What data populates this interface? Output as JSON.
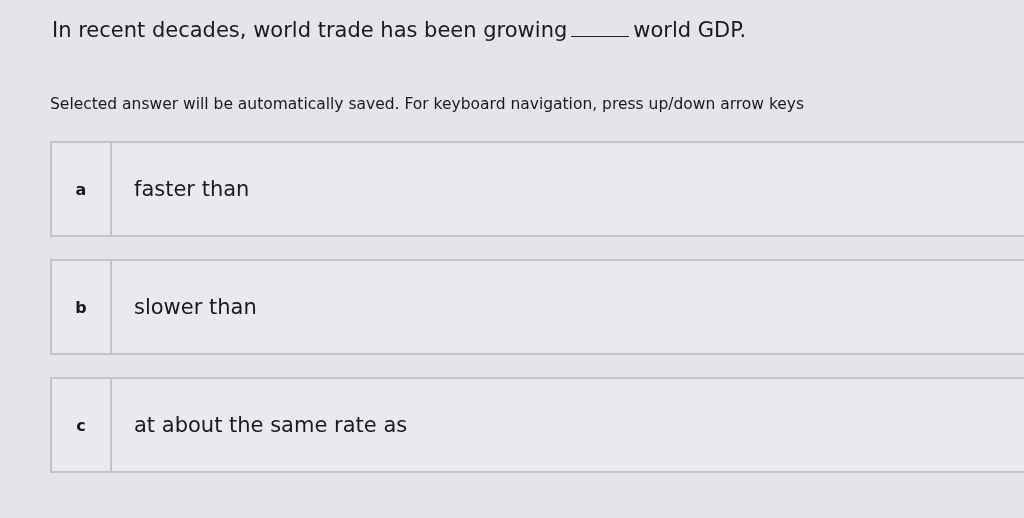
{
  "question": {
    "before": "In recent decades, world trade has been growing",
    "after": "world GDP."
  },
  "instructions": "Selected answer will be automatically saved. For keyboard navigation, press up/down arrow keys",
  "options": [
    {
      "letter": "a",
      "text": "faster than",
      "selected": false
    },
    {
      "letter": "b",
      "text": "slower than",
      "selected": false
    },
    {
      "letter": "c",
      "text": "at about the same rate as",
      "selected": false
    }
  ]
}
